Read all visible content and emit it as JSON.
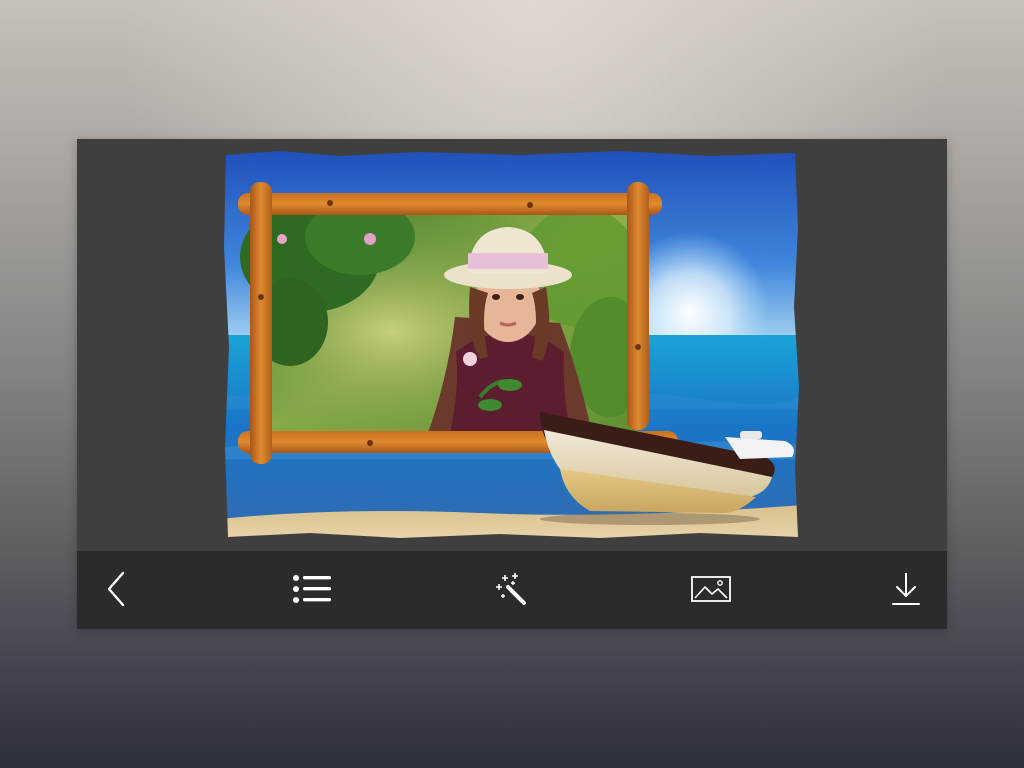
{
  "theme": {
    "window_bg": "#3f3f3f",
    "toolbar_bg": "#2b2b2b",
    "icon_color": "#ffffff"
  },
  "editor": {
    "frame_style": "wooden-branch-frame",
    "scene": "beach-sea-boat"
  },
  "toolbar": {
    "items": [
      {
        "name": "back",
        "icon": "chevron-left-icon"
      },
      {
        "name": "frames-list",
        "icon": "list-icon"
      },
      {
        "name": "effects",
        "icon": "magic-wand-icon"
      },
      {
        "name": "gallery",
        "icon": "image-icon"
      },
      {
        "name": "save",
        "icon": "download-icon"
      }
    ]
  }
}
